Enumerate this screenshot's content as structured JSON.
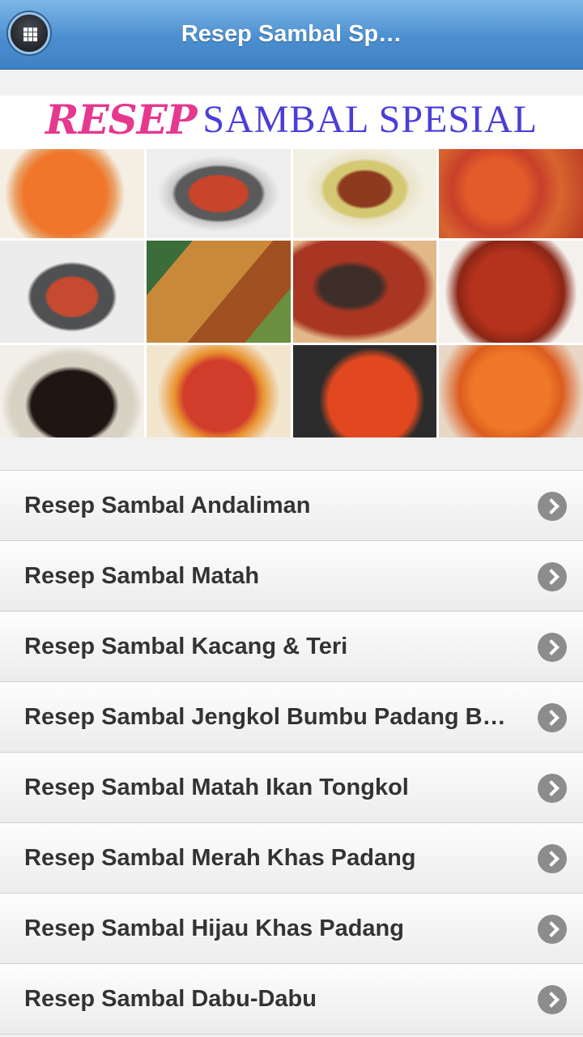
{
  "header": {
    "title": "Resep Sambal Sp…",
    "menu_icon": "grid-menu-icon"
  },
  "banner": {
    "title_script": "RESEP",
    "title_main": "SAMBAL SPESIAL",
    "title_colors": {
      "script": "#e6388f",
      "main": "#4b3ed8"
    },
    "photo_count": 12
  },
  "list": {
    "items": [
      {
        "label": "Resep Sambal Andaliman"
      },
      {
        "label": "Resep Sambal Matah"
      },
      {
        "label": "Resep Sambal Kacang & Teri"
      },
      {
        "label": "Resep Sambal Jengkol Bumbu Padang B…"
      },
      {
        "label": "Resep Sambal Matah Ikan Tongkol"
      },
      {
        "label": "Resep Sambal Merah Khas Padang"
      },
      {
        "label": "Resep Sambal Hijau Khas Padang"
      },
      {
        "label": "Resep Sambal Dabu-Dabu"
      }
    ],
    "arrow_icon": "chevron-right-icon"
  },
  "colors": {
    "header": "#4b8fd0",
    "item_text": "#333333",
    "arrow": "#8c8c8c"
  }
}
